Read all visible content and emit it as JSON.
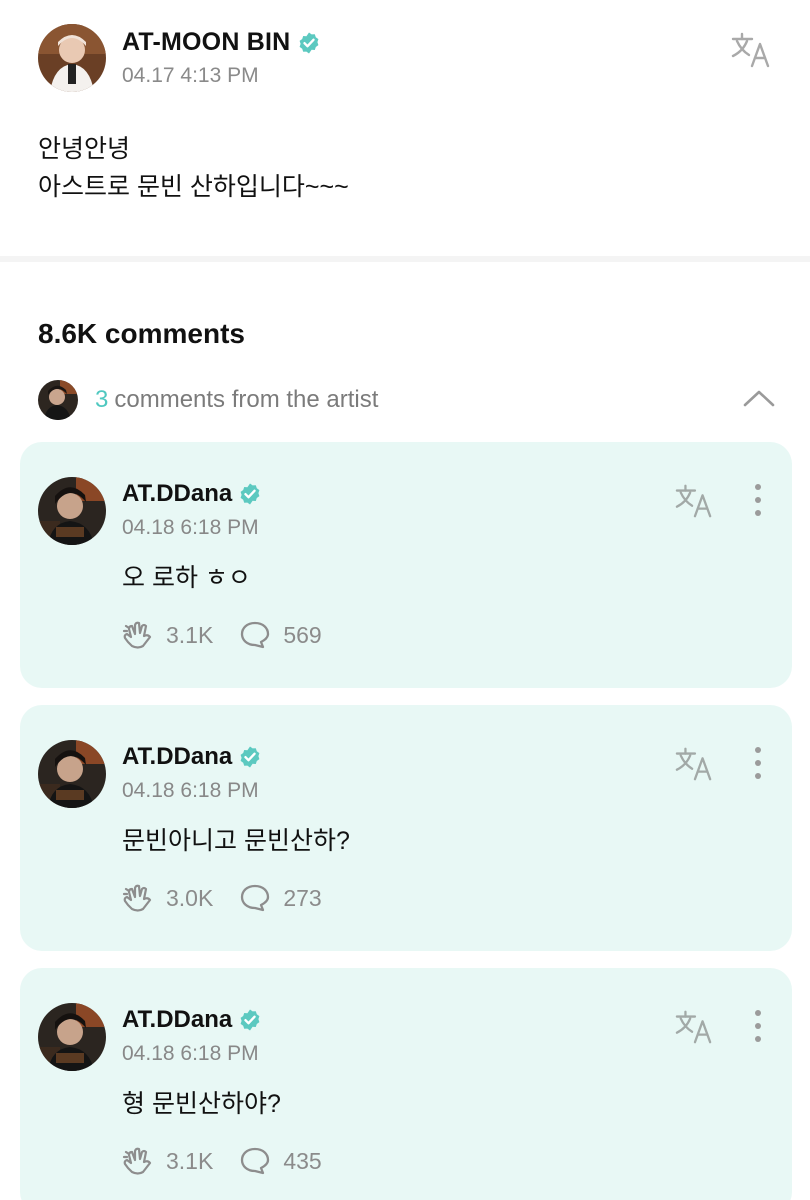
{
  "post": {
    "author": "AT-MOON BIN",
    "timestamp": "04.17 4:13 PM",
    "body_lines": [
      "안녕안녕",
      "아스트로 문빈 산하입니다~~~"
    ]
  },
  "comments_section": {
    "total_label": "8.6K comments",
    "artist_row": {
      "count": "3",
      "label": "comments from the artist"
    }
  },
  "comments": [
    {
      "author": "AT.DDana",
      "timestamp": "04.18 6:18 PM",
      "text": "오 로하 ㅎㅇ",
      "likes": "3.1K",
      "replies": "569"
    },
    {
      "author": "AT.DDana",
      "timestamp": "04.18 6:18 PM",
      "text": "문빈아니고 문빈산하?",
      "likes": "3.0K",
      "replies": "273"
    },
    {
      "author": "AT.DDana",
      "timestamp": "04.18 6:18 PM",
      "text": "형 문빈산하야?",
      "likes": "3.1K",
      "replies": "435"
    }
  ],
  "icons": {
    "verified": "verified-badge-icon",
    "translate": "translate-icon",
    "more": "more-vertical-icon",
    "chevron": "chevron-up-icon",
    "like": "cheer-hand-icon",
    "reply": "speech-bubble-icon"
  },
  "colors": {
    "accent": "#4fc8c0",
    "card_bg": "#e8f8f5",
    "muted_text": "#8a8a8a",
    "verified": "#5cc9c0"
  }
}
